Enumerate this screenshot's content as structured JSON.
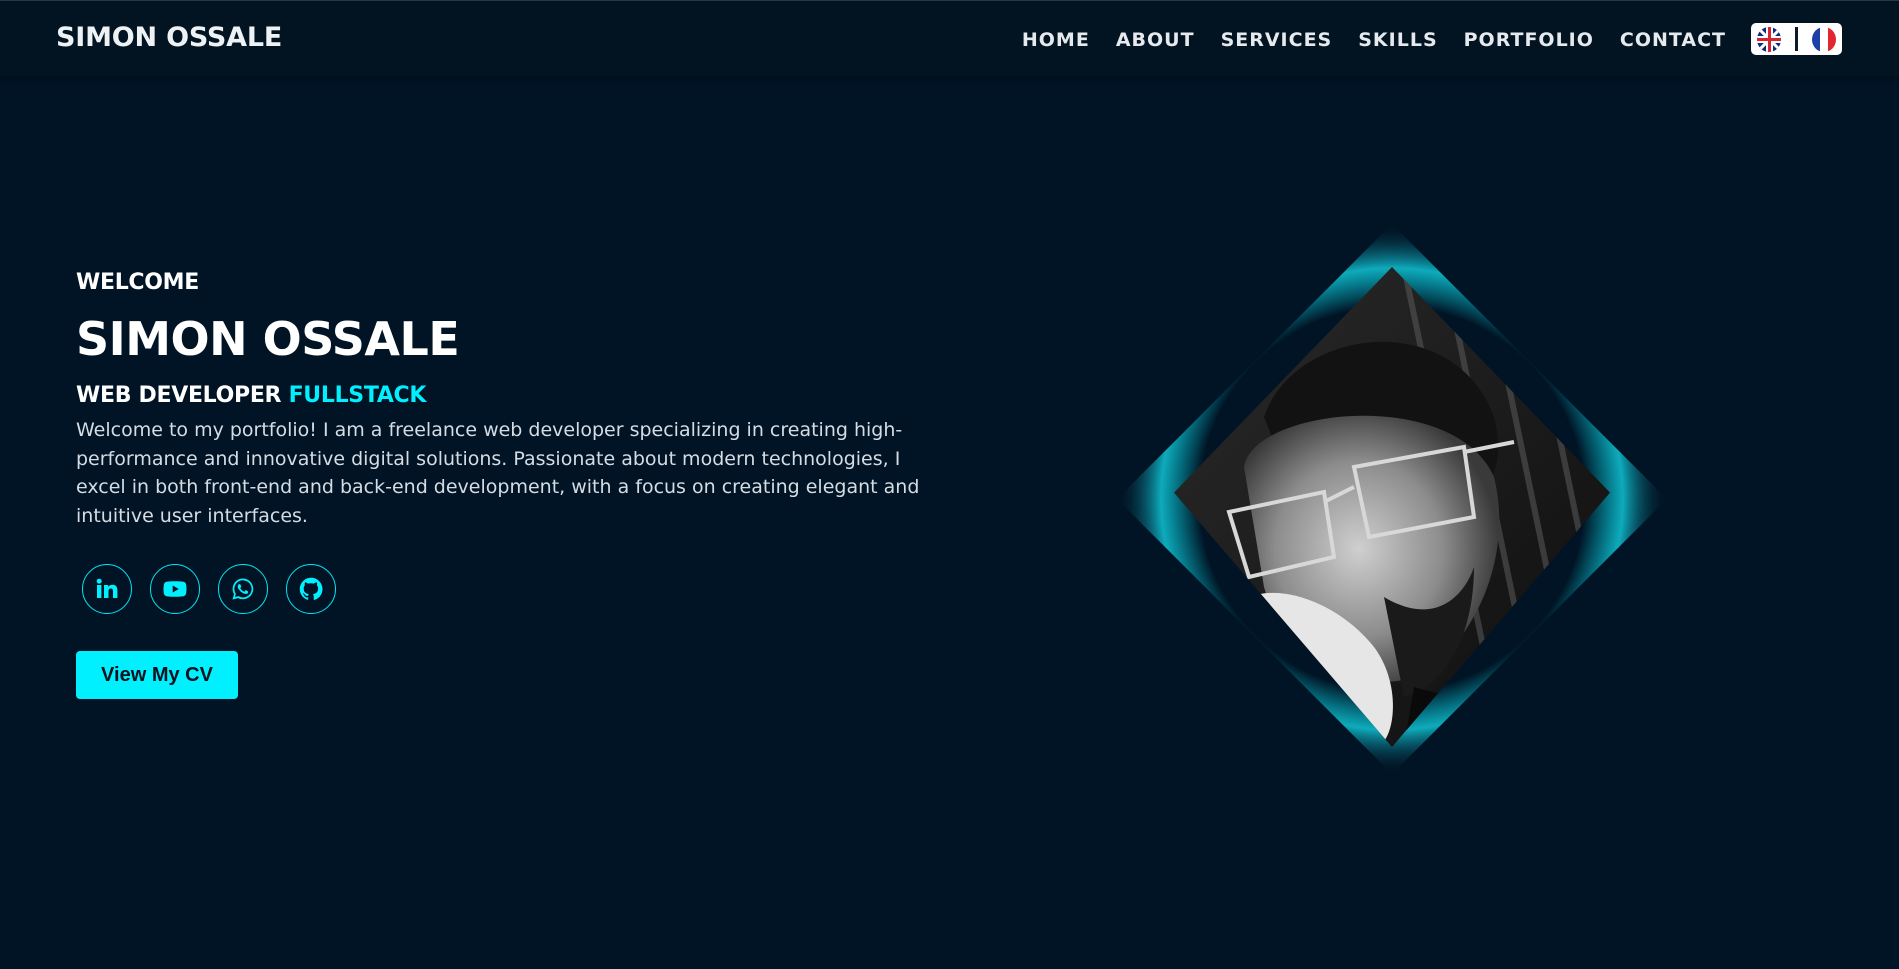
{
  "header": {
    "logo": "SIMON OSSALE",
    "nav": [
      {
        "label": "HOME"
      },
      {
        "label": "ABOUT"
      },
      {
        "label": "SERVICES"
      },
      {
        "label": "SKILLS"
      },
      {
        "label": "PORTFOLIO"
      },
      {
        "label": "CONTACT"
      }
    ],
    "languages": [
      "english-flag-icon",
      "french-flag-icon"
    ]
  },
  "hero": {
    "welcome": "WELCOME",
    "name": "SIMON OSSALE",
    "role_prefix": "WEB DEVELOPER",
    "role_accent": "FULLSTACK",
    "description": "Welcome to my portfolio! I am a freelance web developer specializing in creating high-performance and innovative digital solutions. Passionate about modern technologies, I excel in both front-end and back-end development, with a focus on creating elegant and intuitive user interfaces.",
    "socials": [
      "linkedin-icon",
      "youtube-icon",
      "whatsapp-icon",
      "github-icon"
    ],
    "cv_button": "View My CV"
  },
  "colors": {
    "background": "#011425",
    "accent": "#00f0ff",
    "text": "#ffffff"
  }
}
